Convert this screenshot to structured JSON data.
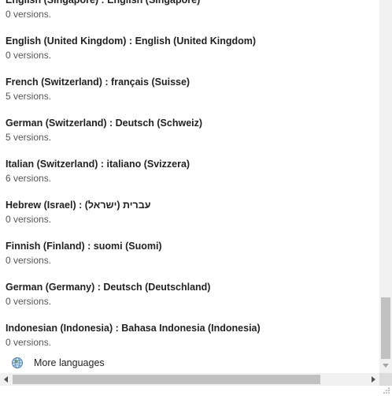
{
  "languages": [
    {
      "name": "English (Singapore) : English (Singapore)",
      "count": "0 versions."
    },
    {
      "name": "English (United Kingdom) : English (United Kingdom)",
      "count": "0 versions."
    },
    {
      "name": "French (Switzerland) : français (Suisse)",
      "count": "5 versions."
    },
    {
      "name": "German (Switzerland) : Deutsch (Schweiz)",
      "count": "5 versions."
    },
    {
      "name": "Italian (Switzerland) : italiano (Svizzera)",
      "count": "6 versions."
    },
    {
      "name": "Hebrew (Israel) : עברית (ישראל)",
      "count": "0 versions."
    },
    {
      "name": "Finnish (Finland) : suomi (Suomi)",
      "count": "0 versions."
    },
    {
      "name": "German (Germany) : Deutsch (Deutschland)",
      "count": "0 versions."
    },
    {
      "name": "Indonesian (Indonesia) : Bahasa Indonesia (Indonesia)",
      "count": "0 versions."
    }
  ],
  "more_languages": {
    "label": "More languages",
    "icon": "globe-icon"
  },
  "colors": {
    "text": "#222222",
    "muted": "#555555",
    "scrollbar_track": "#f1f1f1",
    "scrollbar_thumb": "#c1c1c1"
  }
}
